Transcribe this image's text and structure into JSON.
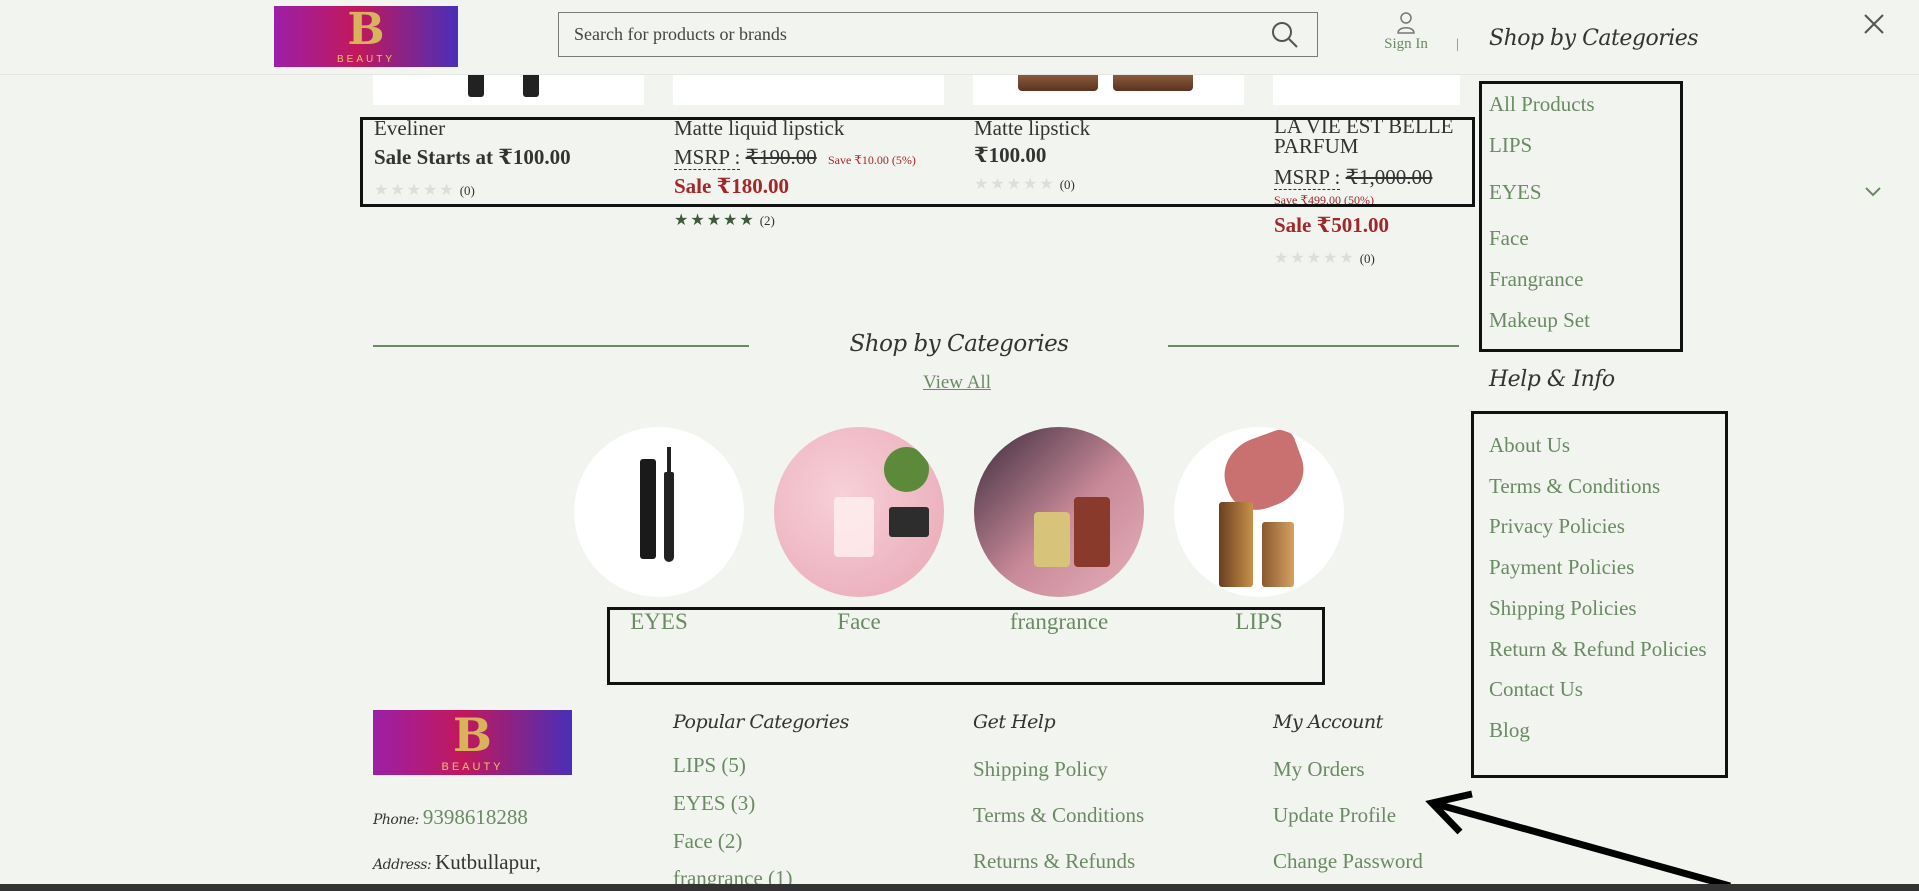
{
  "header": {
    "logo_text": "BEAUTY",
    "search_placeholder": "Search for products or brands",
    "sign_in": "Sign In",
    "separator": "|"
  },
  "products": [
    {
      "name": "Eveliner",
      "price_line": "Sale Starts at ₹100.00",
      "reviews": "(0)",
      "rating": 0
    },
    {
      "name": "Matte liquid lipstick",
      "msrp_label": "MSRP :",
      "msrp": "₹190.00",
      "save": "Save ₹10.00 (5%)",
      "sale_label": "Sale",
      "sale_price": "₹180.00",
      "reviews": "(2)",
      "rating": 5
    },
    {
      "name": "Matte lipstick",
      "price": "₹100.00",
      "reviews": "(0)",
      "rating": 0
    },
    {
      "name": "LA VIE EST BELLE PARFUM",
      "msrp_label": "MSRP :",
      "msrp": "₹1,000.00",
      "save": "Save ₹499.00 (50%)",
      "sale_label": "Sale",
      "sale_price": "₹501.00",
      "reviews": "(0)",
      "rating": 0
    }
  ],
  "categories_section": {
    "title": "Shop by Categories",
    "view_all": "View All",
    "items": [
      {
        "label": "EYES",
        "icon": "eyeliner-image"
      },
      {
        "label": "Face",
        "icon": "face-products-image"
      },
      {
        "label": "frangrance",
        "icon": "perfume-image"
      },
      {
        "label": "LIPS",
        "icon": "lipstick-image"
      }
    ]
  },
  "footer": {
    "logo_text": "BEAUTY",
    "phone_label": "Phone:",
    "phone": "9398618288",
    "address_label": "Address:",
    "address": "Kutbullapur,",
    "popular_title": "Popular Categories",
    "popular": [
      "LIPS (5)",
      "EYES (3)",
      "Face (2)",
      "frangrance (1)"
    ],
    "help_title": "Get Help",
    "help": [
      "Shipping Policy",
      "Terms & Conditions",
      "Returns & Refunds"
    ],
    "account_title": "My Account",
    "account": [
      "My Orders",
      "Update Profile",
      "Change Password"
    ]
  },
  "sidebar": {
    "title": "Shop by Categories",
    "categories": [
      "All Products",
      "LIPS",
      "EYES",
      "Face",
      "Frangrance",
      "Makeup Set"
    ],
    "help_title": "Help & Info",
    "help": [
      "About Us",
      "Terms & Conditions",
      "Privacy Policies",
      "Payment Policies",
      "Shipping Policies",
      "Return & Refund Policies",
      "Contact Us",
      "Blog"
    ]
  },
  "colors": {
    "accent": "#6a8a63",
    "sale": "#a0272a",
    "star": "#3d5a3a"
  }
}
